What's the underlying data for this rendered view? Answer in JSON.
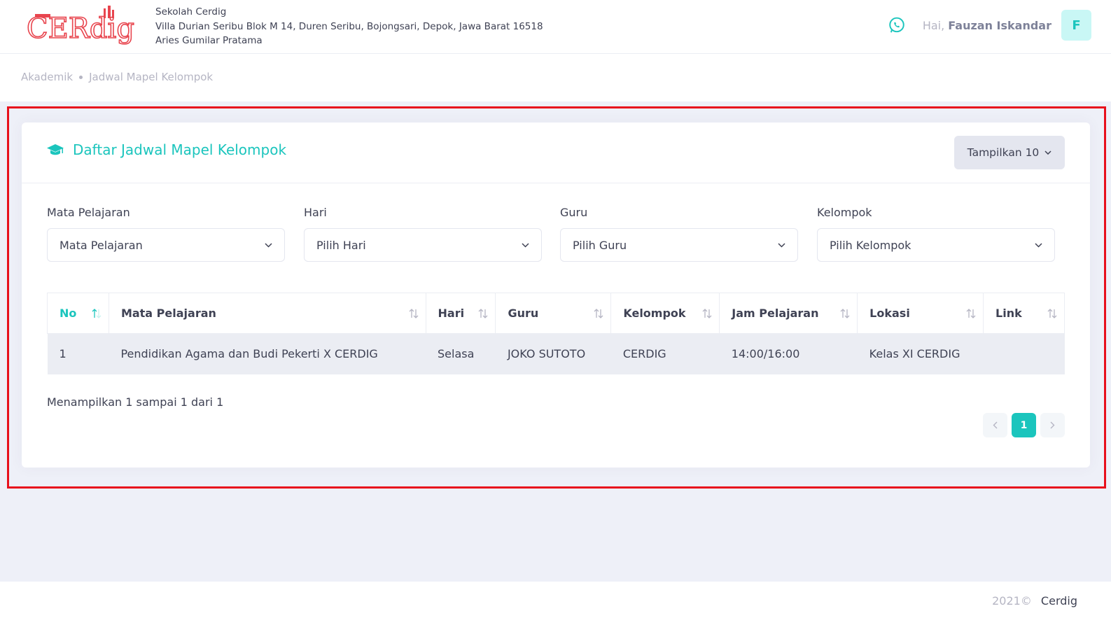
{
  "header": {
    "logo_text": "CERdig",
    "school_name": "Sekolah Cerdig",
    "school_address": "Villa Durian Seribu Blok M 14, Duren Seribu, Bojongsari, Depok, Jawa Barat 16518",
    "principal": "Aries Gumilar Pratama",
    "greeting": "Hai,",
    "user_name": "Fauzan Iskandar",
    "avatar_initial": "F",
    "whatsapp_icon": "whatsapp-icon"
  },
  "breadcrumb": [
    "Akademik",
    "Jadwal Mapel Kelompok"
  ],
  "card": {
    "title": "Daftar Jadwal Mapel Kelompok",
    "title_icon": "graduation-cap-icon",
    "show_button": "Tampilkan 10"
  },
  "filters": [
    {
      "label": "Mata Pelajaran",
      "value": "Mata Pelajaran"
    },
    {
      "label": "Hari",
      "value": "Pilih Hari"
    },
    {
      "label": "Guru",
      "value": "Pilih Guru"
    },
    {
      "label": "Kelompok",
      "value": "Pilih Kelompok"
    }
  ],
  "table": {
    "columns": [
      "No",
      "Mata Pelajaran",
      "Hari",
      "Guru",
      "Kelompok",
      "Jam Pelajaran",
      "Lokasi",
      "Link"
    ],
    "rows": [
      [
        "1",
        "Pendidikan Agama dan Budi Pekerti X CERDIG",
        "Selasa",
        "JOKO SUTOTO",
        "CERDIG",
        "14:00/16:00",
        "Kelas XI CERDIG",
        ""
      ]
    ]
  },
  "summary": "Menampilkan 1 sampai 1 dari 1",
  "pagination": {
    "current": "1"
  },
  "footer": {
    "year": "2021©",
    "brand": "Cerdig"
  },
  "colors": {
    "accent": "#1bc5bd",
    "highlight": "#e8101c",
    "logo": "#e8454e"
  }
}
